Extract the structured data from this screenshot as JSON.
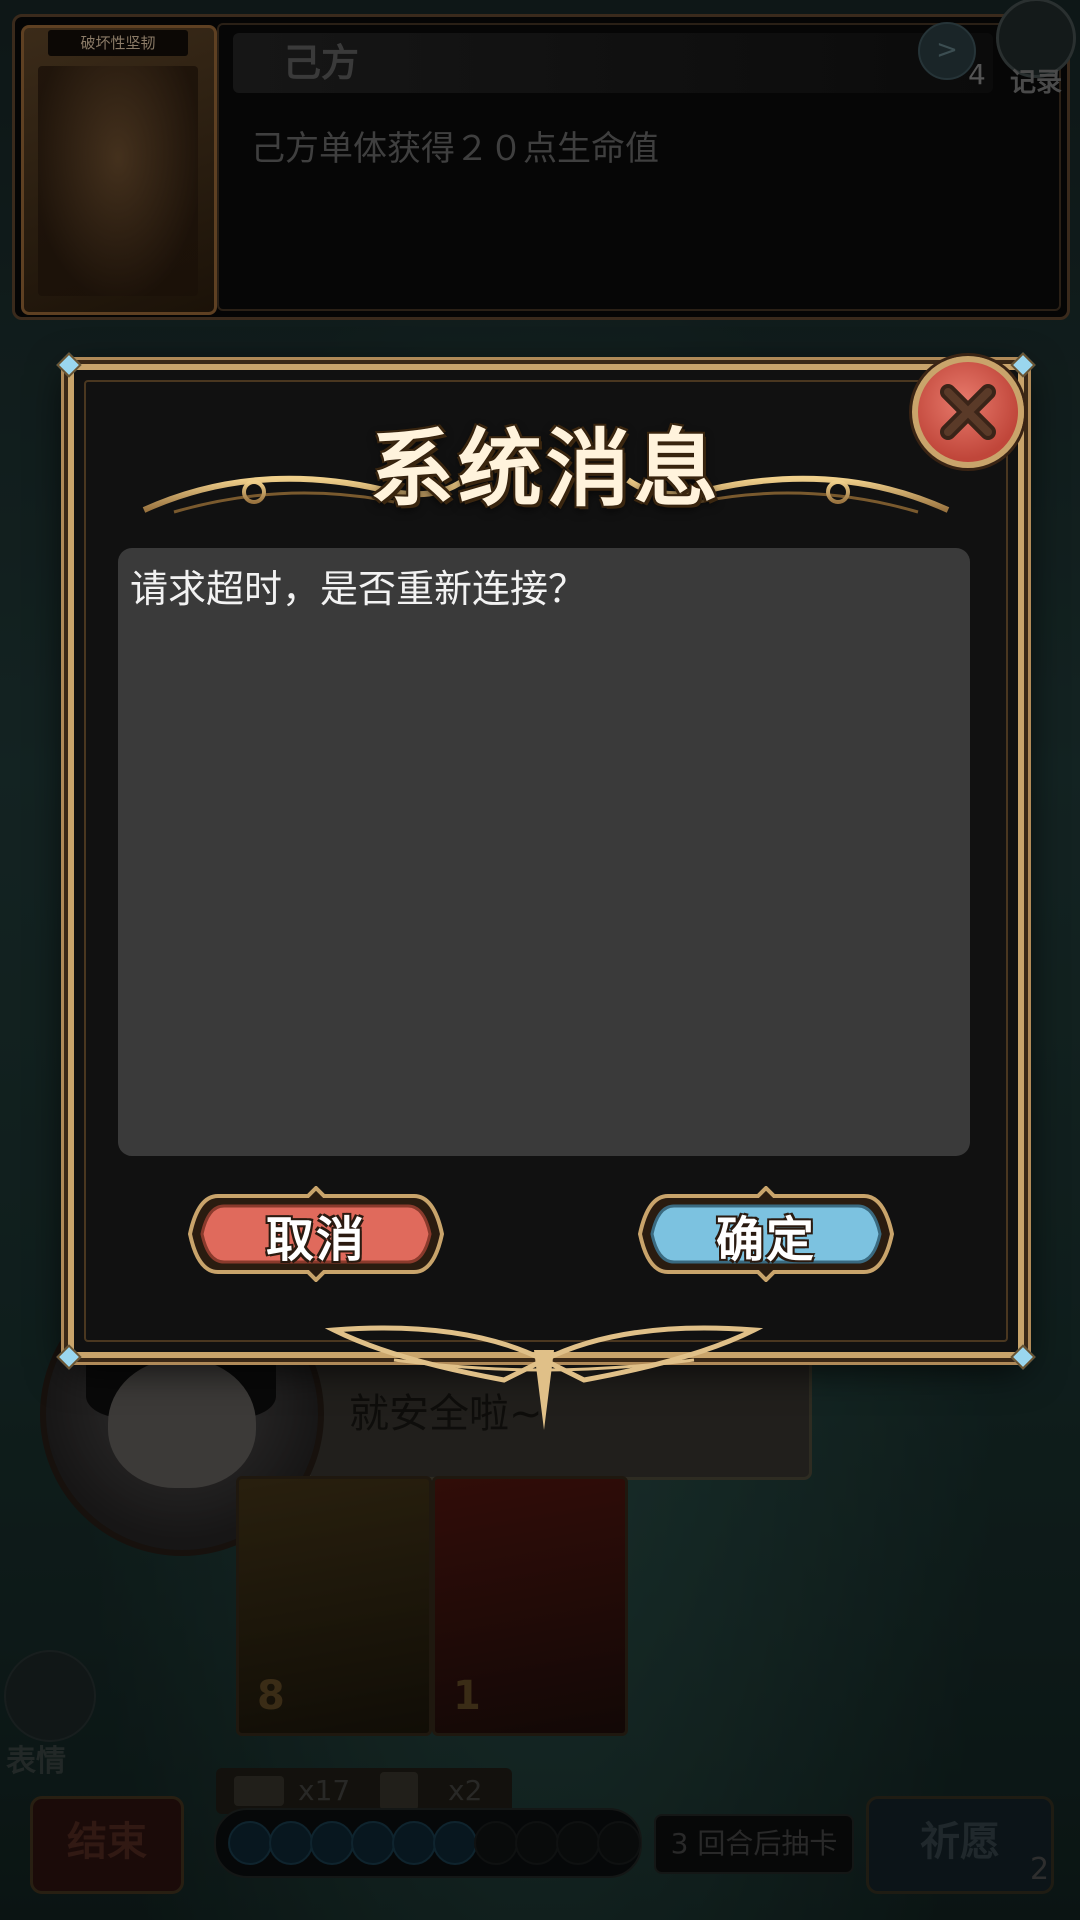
{
  "top_panel": {
    "card_name": "破坏性坚韧",
    "side_label": "己方",
    "effect_text": "己方单体获得２０点生命值",
    "log_count": "4",
    "record_label": "记录",
    "arrow_label": ">"
  },
  "scene": {
    "speech_text": "就安全啦~",
    "hand_cards": [
      {
        "cost": "8"
      },
      {
        "cost": "1"
      }
    ],
    "emote_label": "表情",
    "deck_count": "x17",
    "hand_count": "x2",
    "end_label": "结束",
    "turn_info": "3 回合后抽卡",
    "pray_label": "祈愿",
    "pray_count": "2",
    "mana": {
      "filled": 6,
      "total": 10
    }
  },
  "dialog": {
    "title": "系统消息",
    "message": "请求超时，是否重新连接？",
    "cancel_label": "取消",
    "confirm_label": "确定",
    "close_icon": "close-x-icon"
  },
  "colors": {
    "frame_gold": "#c9a46b",
    "cancel_red": "#e06a5c",
    "confirm_blue": "#7cc2e0",
    "close_red": "#d65a4c"
  }
}
